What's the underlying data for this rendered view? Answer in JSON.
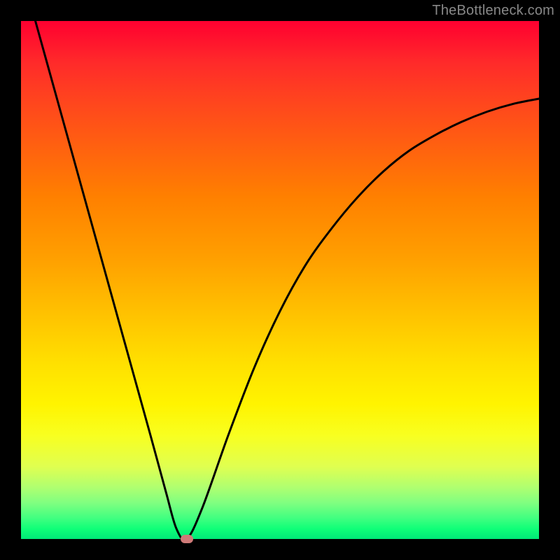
{
  "watermark": "TheBottleneck.com",
  "colors": {
    "frame": "#000000",
    "curve": "#000000",
    "marker": "#cf7a78",
    "gradient_top": "#ff0030",
    "gradient_bottom": "#00e878"
  },
  "chart_data": {
    "type": "line",
    "title": "",
    "xlabel": "",
    "ylabel": "",
    "xlim": [
      0,
      100
    ],
    "ylim": [
      0,
      100
    ],
    "grid": false,
    "series": [
      {
        "name": "bottleneck-curve",
        "x": [
          0,
          5,
          10,
          15,
          20,
          25,
          28,
          30,
          32,
          35,
          40,
          45,
          50,
          55,
          60,
          65,
          70,
          75,
          80,
          85,
          90,
          95,
          100
        ],
        "y": [
          110,
          92,
          74,
          56,
          38,
          20,
          9,
          2,
          0,
          6,
          20,
          33,
          44,
          53,
          60,
          66,
          71,
          75,
          78,
          80.5,
          82.5,
          84,
          85
        ]
      }
    ],
    "annotations": [
      {
        "name": "minimum-marker",
        "x": 32,
        "y": 0
      }
    ]
  }
}
